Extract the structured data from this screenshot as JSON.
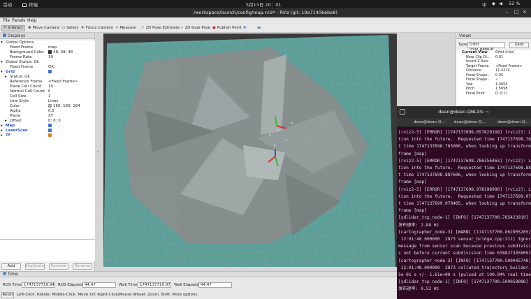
{
  "topbar": {
    "activities": "活动",
    "terminal_app": "终端",
    "clock": "5月13日 20：01",
    "lang": "中",
    "battery": "52 %"
  },
  "window": {
    "title": "/workspace/launch/config/map.rviz* - RViz (git: 19a71406ebe8)"
  },
  "menu": [
    "File",
    "Panels",
    "Help"
  ],
  "toolbar": {
    "interact": "Interact",
    "move_camera": "Move Camera",
    "select": "Select",
    "focus_camera": "Focus Camera",
    "measure": "Measure",
    "pose_estimate": "2D Pose Estimate",
    "goal_pose": "2D Goal Pose",
    "publish_point": "Publish Point"
  },
  "displays": {
    "title": "Displays",
    "rows": [
      {
        "k": "Global Options",
        "v": ""
      },
      {
        "k": "Fixed Frame",
        "v": "map"
      },
      {
        "k": "Background Color",
        "v": "48; 48; 48"
      },
      {
        "k": "Frame Rate",
        "v": "30"
      },
      {
        "k": "Global Status: Ok",
        "v": ""
      },
      {
        "k": "Fixed Frame",
        "v": "OK"
      },
      {
        "k": "Grid",
        "v": ""
      },
      {
        "k": "Status: Ok",
        "v": ""
      },
      {
        "k": "Reference Frame",
        "v": "<Fixed Frame>"
      },
      {
        "k": "Plane Cell Count",
        "v": "10"
      },
      {
        "k": "Normal Cell Count",
        "v": "0"
      },
      {
        "k": "Cell Size",
        "v": "1"
      },
      {
        "k": "Line Style",
        "v": "Lines"
      },
      {
        "k": "Color",
        "v": "160; 160; 164"
      },
      {
        "k": "Alpha",
        "v": "0.5"
      },
      {
        "k": "Plane",
        "v": "XY"
      },
      {
        "k": "Offset",
        "v": "0; 0; 0"
      },
      {
        "k": "Map",
        "v": ""
      },
      {
        "k": "LaserScan",
        "v": ""
      },
      {
        "k": "TF",
        "v": ""
      }
    ],
    "buttons": [
      "Add",
      "Duplicate",
      "Remove",
      "Rename"
    ]
  },
  "views": {
    "title": "Views",
    "type_label": "Type:",
    "type_value": "Orbit (rviz_default_",
    "zero": "Zero",
    "rows": [
      {
        "k": "Current View",
        "v": "Orbit (rviz)"
      },
      {
        "k": "Near Clip Di...",
        "v": "0.01"
      },
      {
        "k": "Invert Z Axis",
        "v": ""
      },
      {
        "k": "Target Frame",
        "v": "<Fixed Frame>"
      },
      {
        "k": "Distance",
        "v": "11.4274"
      },
      {
        "k": "Focal Shape...",
        "v": "0.05"
      },
      {
        "k": "Focal Shape...",
        "v": "✓"
      },
      {
        "k": "Yaw",
        "v": "1.0654"
      },
      {
        "k": "Pitch",
        "v": "1.5698"
      },
      {
        "k": "Focal Point",
        "v": "0; 0; 0"
      }
    ]
  },
  "terminal": {
    "title": "dean@dean-QNLXS: ~",
    "tabs": [
      "dean@dean-Q...",
      "dean@dean-Q...",
      "dean@dean-Q..."
    ],
    "lines": [
      "[rviz2-5] [ERROR] [1747137698.657829168] [rviz2]: Loo",
      "tion into the future.  Requested time 1747137698.7650",
      "t time 1747137698.765066, when looking up transform f",
      "frame [map]",
      "[rviz2-5] [ERROR] [1747137698.786356463] [rviz2]: Loo",
      "tion into the future.  Requested time 1747137698.8876",
      "t time 1747137698.887606, when looking up transform f",
      "frame [map]",
      "[rviz2-5] [ERROR] [1747137698.978198990] [rviz2]: Loo",
      "tion into the future.  Requested time 1747137699.0704",
      "t time 1747137699.070405, when looking up transform f",
      "frame [map]",
      "[ydlidar_tcp_node-1] [INFO] [1747137700.765423919] [yd",
      "发布速率: 2.88 Hz",
      "[cartographer_node-3] [WARN] [1747137700.862905205] [c",
      " 12:01:48.000000  2873 sensor_bridge.cpp:211] Ignored",
      "message from sensor scan because previous subdivisio",
      "s not before current subdivision time 638827345009134",
      "[cartographer_node-3] [INFO] [1747137700.509045748] [c",
      " 12:01:48.000000  2873 collated_trajectory_builder.cc",
      "5e-01 s +/- 1.61e+00 s (pulsed at 100.94% real time)",
      "[ydlidar_tcp_node-1] [INFO] [1747137700.509058088] [yd",
      "发布速率: 0.52 Hz"
    ]
  },
  "time": {
    "title": "Time",
    "ros_time_label": "ROS Time:",
    "ros_time": "1747137719.94",
    "ros_elapsed_label": "ROS Elapsed:",
    "ros_elapsed": "44.47",
    "wall_time_label": "Wall Time:",
    "wall_time": "1747137719.97",
    "wall_elapsed_label": "Wall Elapsed:",
    "wall_elapsed": "44.47",
    "reset": "Reset",
    "hint": "Left-Click: Rotate. Middle-Click: Move X/Y. Right-Click/Mouse Wheel: Zoom. Shift: More options."
  },
  "colors": {
    "background": "#303030",
    "grid": "#a0a0a4",
    "map_teal": "#5f9f9a",
    "terminal_bg": "#300a24"
  }
}
